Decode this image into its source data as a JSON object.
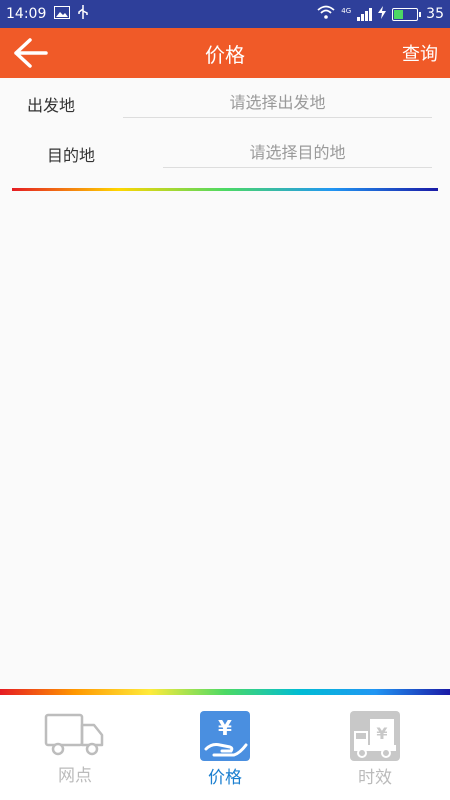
{
  "statusbar": {
    "time": "14:09",
    "battery": "35",
    "network": "4G"
  },
  "appbar": {
    "title": "价格",
    "query_label": "查询"
  },
  "form": {
    "origin": {
      "label": "出发地",
      "placeholder": "请选择出发地"
    },
    "destination": {
      "label": "目的地",
      "placeholder": "请选择目的地"
    }
  },
  "tabs": [
    {
      "label": "网点",
      "icon": "truck-icon",
      "active": false
    },
    {
      "label": "价格",
      "icon": "price-hand-icon",
      "active": true
    },
    {
      "label": "时效",
      "icon": "delivery-truck-yen-icon",
      "active": false
    }
  ],
  "colors": {
    "statusbar": "#2e3f9a",
    "appbar": "#f05a28",
    "active_tab": "#1a7fd0",
    "inactive_tab": "#bbbbbb"
  }
}
